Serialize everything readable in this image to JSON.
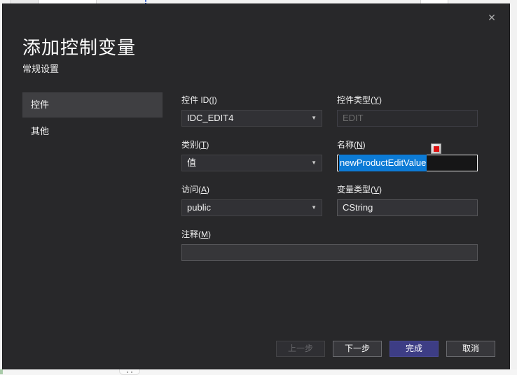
{
  "background": {
    "note": "underlying window edges visible at top and bottom"
  },
  "icons": {
    "close": "✕",
    "dropdown_arrow": "▼"
  },
  "colors": {
    "dialog_bg": "#28282A",
    "accent_button": "#3D3D85",
    "text_selection": "#0C7BD6",
    "marker_red": "#DD1111"
  },
  "dialog": {
    "title": "添加控制变量",
    "subtitle": "常规设置",
    "sidebar": {
      "items": [
        {
          "label": "控件",
          "selected": true
        },
        {
          "label": "其他",
          "selected": false
        }
      ]
    },
    "fields": {
      "control_id": {
        "label_prefix": "控件 ID(",
        "label_key": "I",
        "label_suffix": ")",
        "value": "IDC_EDIT4",
        "type": "combo"
      },
      "control_type": {
        "label_prefix": "控件类型(",
        "label_key": "Y",
        "label_suffix": ")",
        "value": "EDIT",
        "type": "text",
        "disabled": true
      },
      "category": {
        "label_prefix": "类别(",
        "label_key": "T",
        "label_suffix": ")",
        "value": "值",
        "type": "combo"
      },
      "name": {
        "label_prefix": "名称(",
        "label_key": "N",
        "label_suffix": ")",
        "value": "newProductEditValue",
        "type": "text",
        "focused": true,
        "text_selected": true
      },
      "access": {
        "label_prefix": "访问(",
        "label_key": "A",
        "label_suffix": ")",
        "value": "public",
        "type": "combo"
      },
      "variable_type": {
        "label_prefix": "变量类型(",
        "label_key": "V",
        "label_suffix": ")",
        "value": "CString",
        "type": "text"
      },
      "comment": {
        "label_prefix": "注释(",
        "label_key": "M",
        "label_suffix": ")",
        "value": "",
        "type": "text"
      }
    },
    "buttons": {
      "back": "上一步",
      "next": "下一步",
      "finish": "完成",
      "cancel": "取消"
    }
  }
}
